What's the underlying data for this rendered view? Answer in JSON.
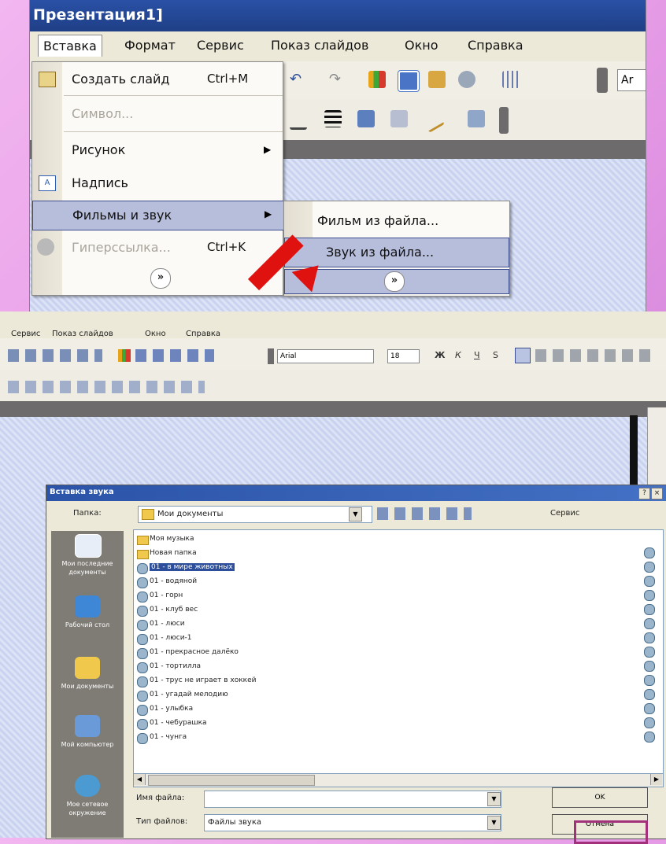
{
  "top": {
    "title": "Презентация1]",
    "menu": [
      "Вставка",
      "Формат",
      "Сервис",
      "Показ слайдов",
      "Окно",
      "Справка"
    ],
    "font_box": "Ar",
    "insert_menu": [
      {
        "label": "Создать слайд",
        "shortcut": "Ctrl+M",
        "disabled": false
      },
      {
        "label": "Символ...",
        "shortcut": "",
        "disabled": true
      },
      {
        "label": "Рисунок",
        "shortcut": "",
        "disabled": false
      },
      {
        "label": "Надпись",
        "shortcut": "",
        "disabled": false
      },
      {
        "label": "Фильмы и звук",
        "shortcut": "",
        "disabled": false
      },
      {
        "label": "Гиперссылка...",
        "shortcut": "Ctrl+K",
        "disabled": true
      }
    ],
    "submenu": [
      "Фильм из файла...",
      "Звук из файла..."
    ],
    "expander": "»"
  },
  "bottom": {
    "menu": [
      "Сервис",
      "Показ слайдов",
      "Окно",
      "Справка"
    ],
    "font": "Arial",
    "font_size": "18",
    "format_buttons": [
      "Ж",
      "К",
      "Ч",
      "S"
    ],
    "dialog": {
      "title": "Вставка звука",
      "help_btn": "?",
      "close_btn": "×",
      "folder_label": "Папка:",
      "folder_value": "Мои документы",
      "tools_label": "Сервис",
      "places": [
        "Мои последние документы",
        "Рабочий стол",
        "Мои документы",
        "Мой компьютер",
        "Мое сетевое окружение"
      ],
      "folders": [
        "Моя музыка",
        "Новая папка"
      ],
      "files": [
        "01 - в мире животных",
        "01 - водяной",
        "01 - горн",
        "01 - клуб вес",
        "01 - люси",
        "01 - люси-1",
        "01 - прекрасное далёко",
        "01 - тортилла",
        "01 - трус не играет в хоккей",
        "01 - угадай мелодию",
        "01 - улыбка",
        "01 - чебурашка",
        "01 - чунга"
      ],
      "filename_label": "Имя файла:",
      "filename_value": "",
      "filetype_label": "Тип файлов:",
      "filetype_value": "Файлы звука",
      "ok": "OK",
      "cancel": "Отмена"
    }
  },
  "colors": {
    "accent": "#e0120f",
    "highlight": "#a3307a",
    "title_bar": "#2a51a6"
  }
}
